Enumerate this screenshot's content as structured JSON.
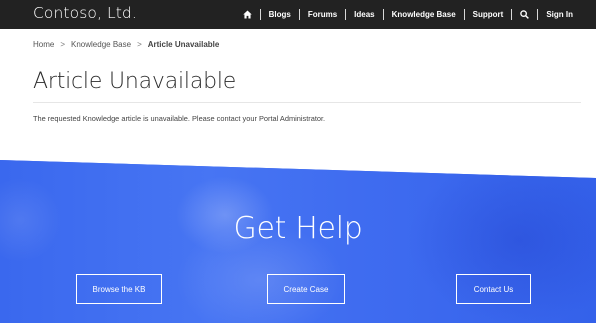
{
  "header": {
    "brand": "Contoso, Ltd.",
    "nav": {
      "home_icon": "home-icon",
      "blogs": "Blogs",
      "forums": "Forums",
      "ideas": "Ideas",
      "knowledge_base": "Knowledge Base",
      "support": "Support",
      "search_icon": "search-icon",
      "sign_in": "Sign In"
    }
  },
  "breadcrumb": {
    "items": [
      "Home",
      "Knowledge Base"
    ],
    "separator": ">",
    "current": "Article Unavailable"
  },
  "main": {
    "title": "Article Unavailable",
    "message": "The requested Knowledge article is unavailable. Please contact your Portal Administrator."
  },
  "help": {
    "title": "Get Help",
    "buttons": {
      "browse_kb": "Browse the KB",
      "create_case": "Create Case",
      "contact_us": "Contact Us"
    }
  },
  "colors": {
    "topbar": "#222222",
    "hero_blue": "#3d6cf2",
    "text": "#2b2b2b"
  }
}
